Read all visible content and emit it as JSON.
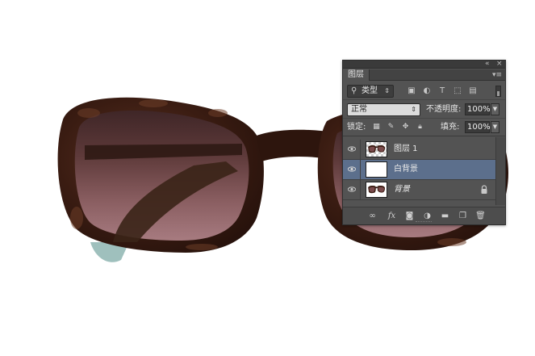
{
  "panel": {
    "collapse_icon": "double-chevron-icon",
    "close_icon": "close-icon",
    "tab_label": "图层",
    "menu_icon": "panel-menu-icon"
  },
  "filter": {
    "kind_label": "类型",
    "search_icon": "search-icon",
    "icons": [
      "image-filter-icon",
      "adjustment-filter-icon",
      "type-filter-icon",
      "shape-filter-icon",
      "smart-object-filter-icon"
    ]
  },
  "blend": {
    "mode": "正常",
    "opacity_label": "不透明度:",
    "opacity_value": "100%"
  },
  "lock": {
    "label": "锁定:",
    "fill_label": "填充:",
    "fill_value": "100%",
    "icons": [
      "lock-transparent-icon",
      "lock-image-icon",
      "lock-position-icon",
      "lock-all-icon"
    ]
  },
  "layers": [
    {
      "name": "图层 1",
      "visible": true,
      "selected": false,
      "thumb": "sunglasses-transparent"
    },
    {
      "name": "白背景",
      "visible": true,
      "selected": true,
      "thumb": "white"
    },
    {
      "name": "背景",
      "visible": true,
      "selected": false,
      "thumb": "sunglasses",
      "locked": true,
      "italic": true
    }
  ],
  "footer_icons": [
    "link-layers-icon",
    "fx-icon",
    "add-mask-icon",
    "adjustment-layer-icon",
    "new-group-icon",
    "new-layer-icon",
    "trash-icon"
  ],
  "colors": {
    "panel_bg": "#535353",
    "selected_row": "#5c6f8c",
    "frame_tortoise": "#3a1c12",
    "lens": "#7a4b4c",
    "temple_tip": "#9fc0bd"
  }
}
